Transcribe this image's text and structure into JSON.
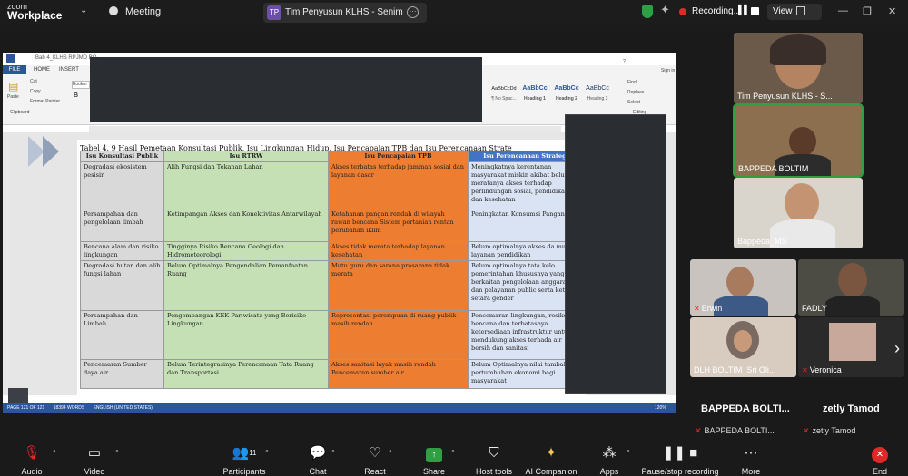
{
  "app": {
    "line1": "zoom",
    "line2": "Workplace"
  },
  "meeting": {
    "label": "Meeting"
  },
  "tab": {
    "initials": "TP",
    "title": "Tim Penyusun KLHS - Senimiawa"
  },
  "recording": {
    "label": "Recording..."
  },
  "view": {
    "label": "View"
  },
  "word": {
    "title": "Bab 4_KLHS RPJMD BO",
    "tabs": [
      "FILE",
      "HOME",
      "INSERT"
    ],
    "clipboard": [
      "Cut",
      "Copy",
      "Format Painter"
    ],
    "paste": "Paste",
    "clipboard_group": "Clipboard",
    "font_box": "Bookm",
    "styles": [
      {
        "sample": "AaBbCcDd",
        "name": "¶ No Spac..."
      },
      {
        "sample": "AaBbCc",
        "name": "Heading 1"
      },
      {
        "sample": "AaBbCc",
        "name": "Heading 2"
      },
      {
        "sample": "AaBbCc",
        "name": "Heading 3"
      }
    ],
    "editing": [
      "Find",
      "Replace",
      "Select"
    ],
    "editing_group": "Editing",
    "signin": "Sign in",
    "status_left": "PAGE 121 OF 121",
    "status_words": "18394 WORDS",
    "status_lang": "ENGLISH (UNITED STATES)",
    "zoom": "120%"
  },
  "doc": {
    "caption": "Tabel 4. 9 Hasil Pemetaan Konsultasi Publik, Isu Lingkungan Hidup, Isu Pencapaian TPB dan Isu Perencanaan Strate",
    "headers": [
      "Isu Konsultasi Publik",
      "Isu RTRW",
      "Isu Pencapaian TPB",
      "Isu Perencanaan Strateg"
    ],
    "rows": [
      [
        "Degradasi ekosistem pesisir",
        "Alih Fungsi dan Tekanan Lahan",
        "Akses terbatas terhadap jaminan sosial dan layanan dasar",
        "Meningkatnya kerentanan masyarakat miskin akibat belum merata­nya akses terhadap perlindungan sosial, pendidikan, dan kesehatan"
      ],
      [
        "Persampahan dan pengelolaan limbah",
        "Ketimpangan Akses dan Konektivitas Antarwilayah",
        "Ketahanan pangan rendah di wilayah rawan bencana Sistem pertanian rentan perubahan iklim",
        "Peningkatan Konsumsi Pangan"
      ],
      [
        "Bencana alam dan risiko lingkungan",
        "Tingginya Risiko Bencana Geologi dan Hidrometeorologi",
        "Akses tidak merata terhadap layanan kesehatan",
        "Belum optimalnya akses da mutu layanan pendidikan"
      ],
      [
        "Degradasi hutan dan alih fungsi lahan",
        "Belum Optimalnya Pengendalian Pemanfaatan Ruang",
        "Mutu guru dan sarana prasarana tidak merata",
        "Belum optimalnya tata kelo pemerintahan khususnya yang berkaitan pengelolaan anggaran dan pelayanan public serta ketidak setara gender"
      ],
      [
        "Persampahan dan Limbah",
        "Pengembangan KEK Pariwisata yang Berisiko Lingkungan",
        "Representasi perempuan di ruang publik masih rendah",
        "Pencemaran lingkungan, resiko bencana dan terbatasnya ketersediaan infrastruktur untuk mendukung akses terhada air bersih dan sanitasi"
      ],
      [
        "Pencemaran Sumber daya air",
        "Belum Terintegrasinya Perencanaan Tata Ruang dan Transportasi",
        "Akses sanitasi layak masih rendah Pencemaran sumber air",
        "Belum Optimalnya nilai tambah pertumbuhan ekonomi bagi masyarakat"
      ]
    ]
  },
  "participants": {
    "tiles": [
      {
        "name": "Tim Penyusun KLHS - S..."
      },
      {
        "name": "BAPPEDA BOLTIM"
      },
      {
        "name": "Bappeda_MS"
      },
      {
        "name": "Erwin"
      },
      {
        "name": "FADLY"
      },
      {
        "name": "DLH BOLTIM_Sri Oli..."
      },
      {
        "name": "Veronica"
      }
    ],
    "big1": "BAPPEDA BOLTI...",
    "big2": "zetly Tamod",
    "small1": "BAPPEDA BOLTI...",
    "small2": "zetly Tamod",
    "count": "11"
  },
  "toolbar": {
    "audio": "Audio",
    "video": "Video",
    "participants": "Participants",
    "chat": "Chat",
    "react": "React",
    "share": "Share",
    "host_tools": "Host tools",
    "ai": "AI Companion",
    "apps": "Apps",
    "pause": "Pause/stop recording",
    "more": "More",
    "end": "End"
  },
  "colors": {
    "accent": "#2ea043",
    "danger": "#e02828",
    "word_blue": "#2b579a",
    "tpb_orange": "#ed7d31",
    "rtrw_green": "#c5e0b4"
  }
}
